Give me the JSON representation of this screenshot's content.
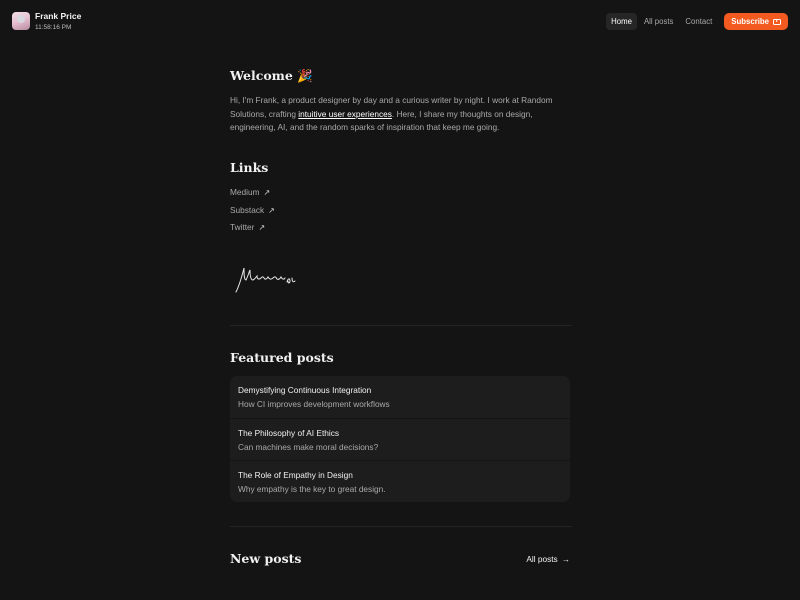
{
  "header": {
    "user_name": "Frank Price",
    "time": "11:58:16 PM",
    "nav": [
      {
        "label": "Home",
        "active": true
      },
      {
        "label": "All posts"
      },
      {
        "label": "Contact"
      }
    ],
    "subscribe_label": "Subscribe",
    "subscribe_icon": "youtube-icon"
  },
  "welcome": {
    "title": "Welcome 🎉",
    "bio_before": "Hi, I'm Frank, a product designer by day and a curious writer by night. I work at Random Solutions, crafting ",
    "bio_link": "intuitive user experiences",
    "bio_after": ". Here, I share my thoughts on design, engineering, AI, and the random sparks of inspiration that keep me going."
  },
  "links": {
    "title": "Links",
    "items": [
      {
        "label": "Medium",
        "icon": "arrow-up-right-icon"
      },
      {
        "label": "Substack",
        "icon": "arrow-up-right-icon"
      },
      {
        "label": "Twitter",
        "icon": "arrow-up-right-icon"
      }
    ],
    "arrow_glyph": "↗"
  },
  "featured": {
    "title": "Featured posts",
    "posts": [
      {
        "title": "Demystifying Continuous Integration",
        "desc": "How CI improves development workflows"
      },
      {
        "title": "The Philosophy of AI Ethics",
        "desc": "Can machines make moral decisions?"
      },
      {
        "title": "The Role of Empathy in Design",
        "desc": "Why empathy is the key to great design."
      }
    ]
  },
  "new_posts": {
    "title": "New posts",
    "all_label": "All posts",
    "all_arrow": "→"
  },
  "colors": {
    "background": "#141414",
    "accent": "#f25a1f",
    "card": "#1d1d1d"
  }
}
